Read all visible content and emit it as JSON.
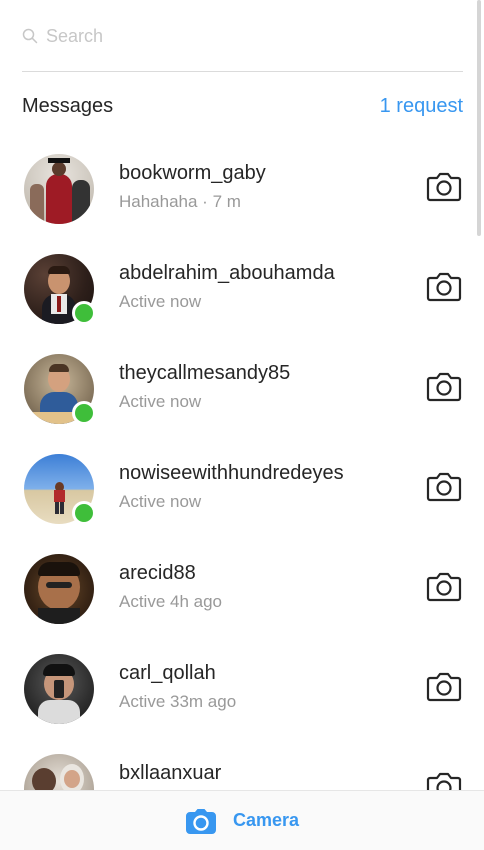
{
  "search": {
    "placeholder": "Search"
  },
  "header": {
    "title": "Messages",
    "requests": "1 request"
  },
  "conversations": [
    {
      "username": "bookworm_gaby",
      "status": "Hahahaha · 7 m",
      "online": false
    },
    {
      "username": "abdelrahim_abouhamda",
      "status": "Active now",
      "online": true
    },
    {
      "username": "theycallmesandy85",
      "status": "Active now",
      "online": true
    },
    {
      "username": "nowiseewithhundredeyes",
      "status": "Active now",
      "online": true
    },
    {
      "username": "arecid88",
      "status": "Active 4h ago",
      "online": false
    },
    {
      "username": "carl_qollah",
      "status": "Active 33m ago",
      "online": false
    },
    {
      "username": "bxllaanxuar",
      "status": "",
      "online": false
    }
  ],
  "bottom_bar": {
    "camera_label": "Camera"
  },
  "colors": {
    "accent": "#3897f0",
    "online": "#3fbe3a",
    "secondary_text": "#999999"
  }
}
